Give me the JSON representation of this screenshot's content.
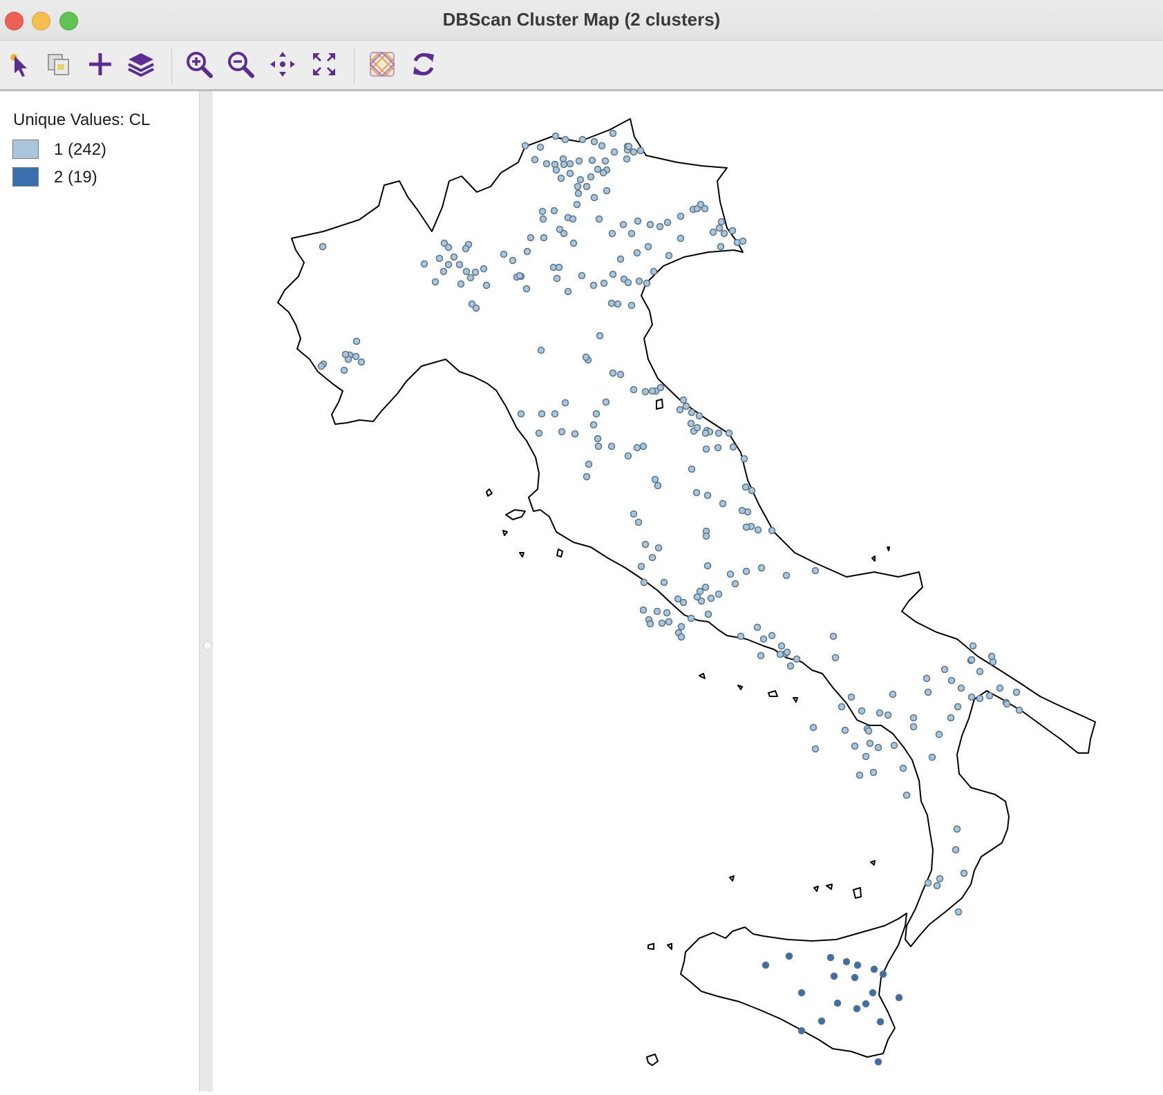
{
  "window": {
    "title": "DBScan Cluster Map (2 clusters)"
  },
  "toolbar": {
    "tools": [
      {
        "name": "select-tool-button",
        "icon": "select-arrow-icon"
      },
      {
        "name": "copy-map-button",
        "icon": "copy-image-icon"
      },
      {
        "name": "add-layer-button",
        "icon": "plus-icon"
      },
      {
        "name": "layers-button",
        "icon": "layers-icon"
      },
      {
        "name": "zoom-in-button",
        "icon": "zoom-in-icon"
      },
      {
        "name": "zoom-out-button",
        "icon": "zoom-out-icon"
      },
      {
        "name": "pan-button",
        "icon": "pan-arrows-icon"
      },
      {
        "name": "full-extent-button",
        "icon": "full-extent-icon"
      },
      {
        "name": "basemap-button",
        "icon": "basemap-icon"
      },
      {
        "name": "refresh-button",
        "icon": "refresh-icon"
      }
    ]
  },
  "legend": {
    "title": "Unique Values: CL",
    "items": [
      {
        "label": "1 (242)",
        "color": "#a9c6dd"
      },
      {
        "label": "2 (19)",
        "color": "#3a6fae"
      }
    ]
  },
  "map": {
    "outline_color": "#000000",
    "point_stroke": "#5a7388",
    "cluster_colors": {
      "1": "#a9c6dd",
      "2": "#3a6fae"
    }
  }
}
